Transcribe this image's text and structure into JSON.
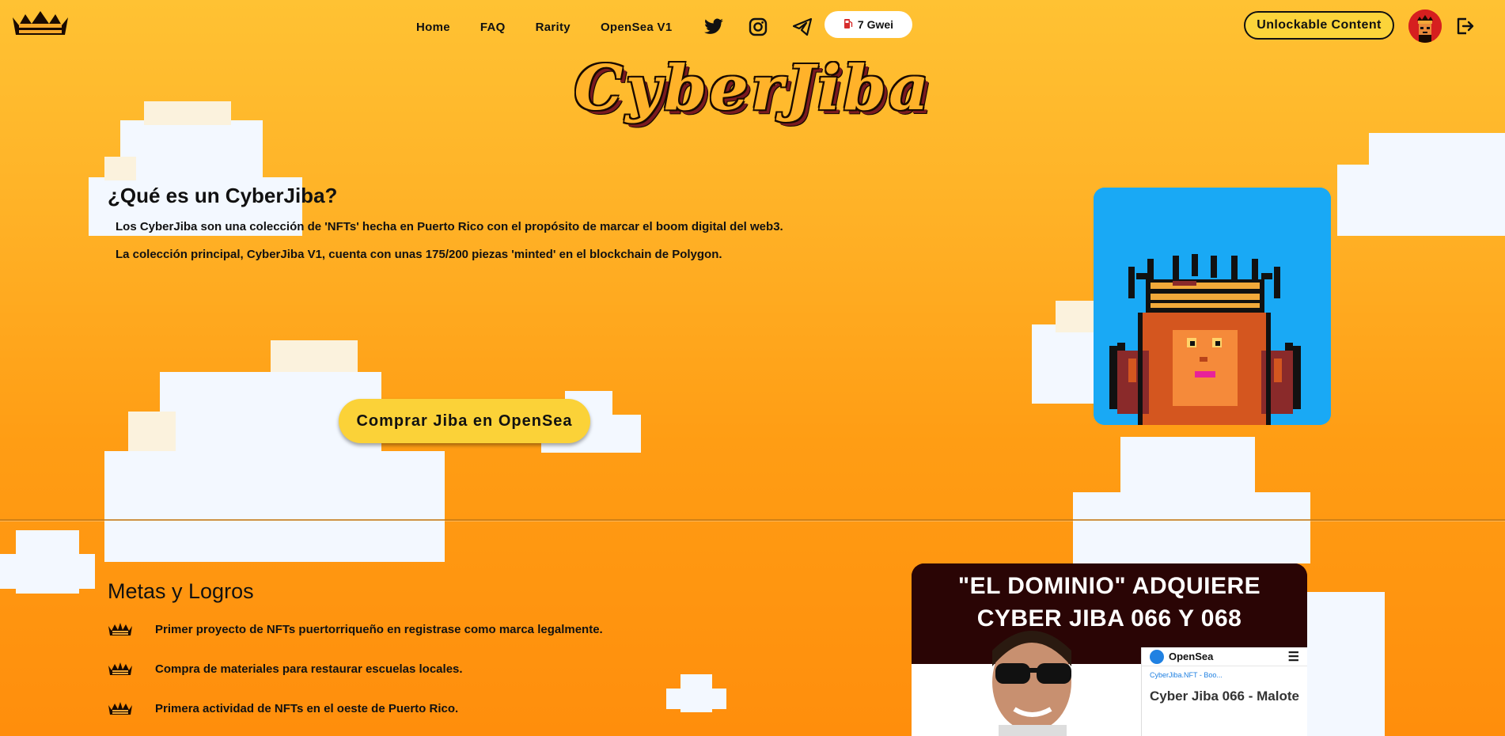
{
  "nav": {
    "links": [
      "Home",
      "FAQ",
      "Rarity",
      "OpenSea V1"
    ],
    "social_icons": [
      "twitter-icon",
      "instagram-icon",
      "telegram-icon"
    ],
    "gas": {
      "icon": "gas-pump-icon",
      "label": "7 Gwei"
    },
    "unlock_label": "Unlockable Content",
    "logout_icon": "logout-icon"
  },
  "brand": {
    "title": "CyberJiba"
  },
  "about": {
    "heading": "¿Qué es un CyberJiba?",
    "paragraphs": [
      "Los CyberJiba son una colección de 'NFTs' hecha en Puerto Rico con el propósito de marcar el boom digital del web3.",
      "La colección principal, CyberJiba V1, cuenta con unas 175/200 piezas 'minted' en el blockchain de Polygon."
    ],
    "buy_label": "Comprar Jiba en OpenSea"
  },
  "goals": {
    "heading": "Metas y Logros",
    "items": [
      "Primer proyecto de NFTs puertorriqueño en registrase como marca legalmente.",
      "Compra de materiales para restaurar escuelas locales.",
      "Primera actividad de NFTs en el oeste de Puerto Rico."
    ]
  },
  "news": {
    "headline_line1": "\"EL DOMINIO\" ADQUIERE",
    "headline_line2": "CYBER JIBA 066 Y 068",
    "opensea_brand": "OpenSea",
    "opensea_tab": "CyberJiba.NFT - Boo...",
    "item_title": "Cyber Jiba 066 - Malote"
  },
  "colors": {
    "bg_top": "#ffc233",
    "bg_bottom": "#ff8e0c",
    "button_yellow": "#fbd238",
    "nft_bg": "#19a9f5",
    "news_bg": "#2a0505"
  }
}
